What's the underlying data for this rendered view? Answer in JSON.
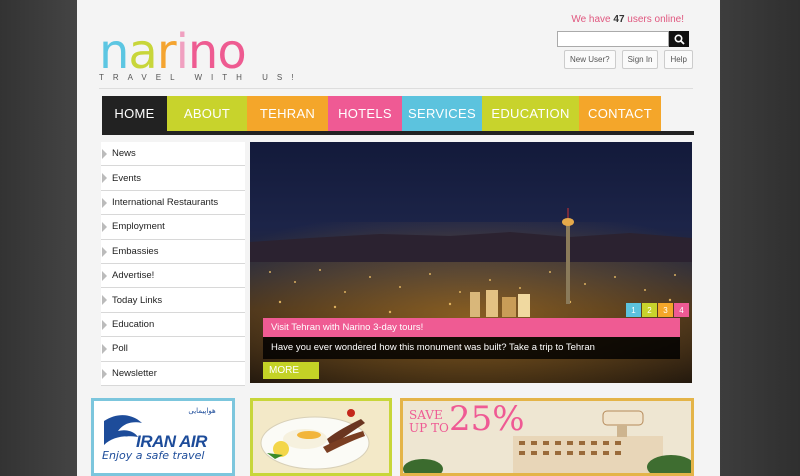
{
  "logo": {
    "letters": [
      {
        "ch": "n",
        "color": "#5cc6e2"
      },
      {
        "ch": "a",
        "color": "#c8d63a"
      },
      {
        "ch": "r",
        "color": "#f4a430"
      },
      {
        "ch": "i",
        "color": "#f0a0c0"
      },
      {
        "ch": "n",
        "color": "#ee5b91"
      },
      {
        "ch": "o",
        "color": "#ee5b91"
      }
    ],
    "tagline": "TRAVEL WITH US!"
  },
  "online": {
    "prefix": "We have",
    "count": "47",
    "suffix": "users online!"
  },
  "search": {
    "placeholder": "",
    "button_icon": "search-icon"
  },
  "top_links": [
    "New User?",
    "Sign In",
    "Help"
  ],
  "nav": [
    {
      "label": "HOME",
      "color": "#222222"
    },
    {
      "label": "ABOUT",
      "color": "#c8d32c"
    },
    {
      "label": "TEHRAN",
      "color": "#f4a62a"
    },
    {
      "label": "HOTELS",
      "color": "#ef5a94"
    },
    {
      "label": "SERVICES",
      "color": "#5cc3de"
    },
    {
      "label": "EDUCATION",
      "color": "#c8d32c"
    },
    {
      "label": "CONTACT",
      "color": "#f4a62a"
    }
  ],
  "sidebar": [
    "News",
    "Events",
    "International Restaurants",
    "Employment",
    "Embassies",
    "Advertise!",
    "Today Links",
    "Education",
    "Poll",
    "Newsletter"
  ],
  "slider": {
    "pages": [
      {
        "label": "1",
        "color": "#5cc3de"
      },
      {
        "label": "2",
        "color": "#c8d32c"
      },
      {
        "label": "3",
        "color": "#f4a62a"
      },
      {
        "label": "4",
        "color": "#ef5a94"
      }
    ],
    "title": "Visit Tehran with Narino 3-day tours!",
    "body": "Have you ever wondered how this monument was built? Take a trip to Tehran",
    "more": "MORE"
  },
  "banners": {
    "airline": {
      "name": "IRAN AIR",
      "slogan": "Enjoy a safe travel"
    },
    "sale": {
      "line1": "SAVE",
      "line2": "UP TO",
      "percent": "25%"
    }
  }
}
